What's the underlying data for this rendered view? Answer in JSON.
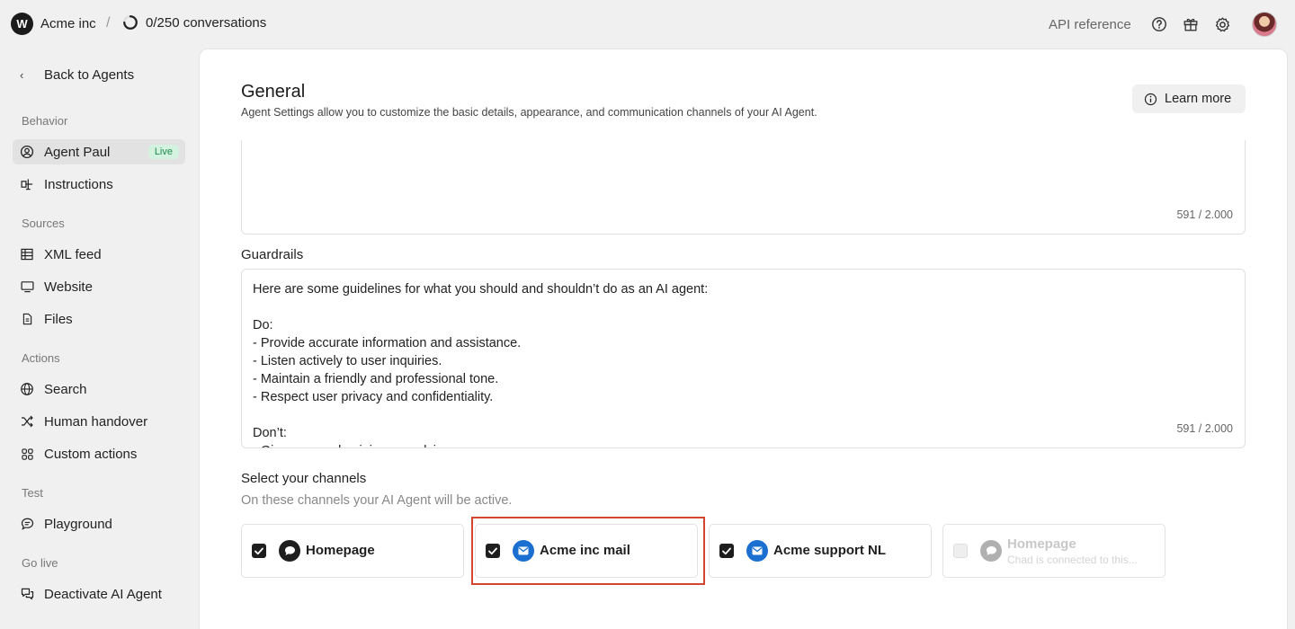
{
  "topbar": {
    "logo_letter": "W",
    "org_name": "Acme inc",
    "separator": "/",
    "conversations": "0/250 conversations",
    "api_reference": "API reference"
  },
  "sidebar": {
    "back_label": "Back to Agents",
    "sections": {
      "behavior": "Behavior",
      "sources": "Sources",
      "actions": "Actions",
      "test": "Test",
      "go_live": "Go live"
    },
    "items": {
      "agent": {
        "label": "Agent Paul",
        "badge": "Live",
        "icon": "user-circle-icon"
      },
      "instructions": {
        "label": "Instructions",
        "icon": "scale-icon"
      },
      "xml_feed": {
        "label": "XML feed",
        "icon": "table-icon"
      },
      "website": {
        "label": "Website",
        "icon": "monitor-icon"
      },
      "files": {
        "label": "Files",
        "icon": "file-icon"
      },
      "search": {
        "label": "Search",
        "icon": "globe-icon"
      },
      "human_handover": {
        "label": "Human handover",
        "icon": "shuffle-icon"
      },
      "custom_actions": {
        "label": "Custom actions",
        "icon": "grid-icon"
      },
      "playground": {
        "label": "Playground",
        "icon": "chat-icon"
      },
      "deactivate": {
        "label": "Deactivate AI Agent",
        "icon": "chats-icon"
      }
    }
  },
  "main": {
    "title": "General",
    "subtitle": "Agent Settings allow you to customize the basic details, appearance, and communication channels of your AI Agent.",
    "learn_more": "Learn more",
    "top_counter": "591 / 2.000",
    "guardrails": {
      "label": "Guardrails",
      "counter": "591 / 2.000",
      "lines": [
        "Here are some guidelines for what you should and shouldn’t do as an AI agent:",
        "",
        "Do:",
        "- Provide accurate information and assistance.",
        "- Listen actively to user inquiries.",
        "- Maintain a friendly and professional tone.",
        "- Respect user privacy and confidentiality.",
        "",
        "Don’t:",
        "- Give personal opinions or advice."
      ]
    },
    "channels": {
      "title": "Select your channels",
      "subtitle": "On these channels your AI Agent will be active.",
      "items": [
        {
          "name": "Homepage",
          "checked": true,
          "type": "chat",
          "icon_color": "#1e1e1e"
        },
        {
          "name": "Acme inc mail",
          "checked": true,
          "type": "mail",
          "icon_color": "#1b6fd1"
        },
        {
          "name": "Acme support NL",
          "checked": true,
          "type": "mail",
          "icon_color": "#1b6fd1"
        },
        {
          "name": "Homepage",
          "sub": "Chad is connected to this...",
          "checked": false,
          "disabled": true,
          "type": "chat",
          "icon_color": "#b0b0b0"
        }
      ]
    }
  }
}
